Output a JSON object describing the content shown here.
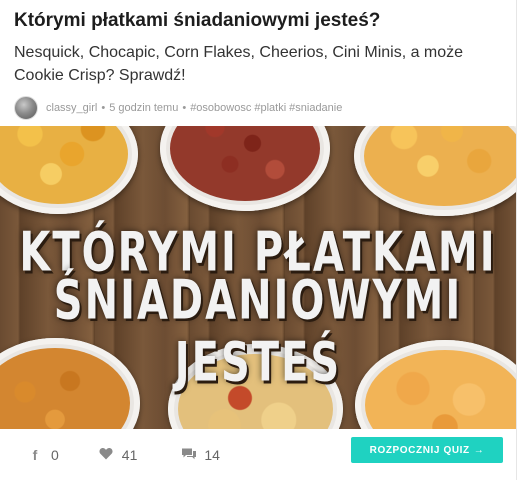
{
  "quiz": {
    "title": "Którymi płatkami śniadaniowymi jesteś?",
    "description": "Nesquick, Chocapic, Corn Flakes, Cheerios, Cini Minis, a może Cookie Crisp? Sprawdź!",
    "author": "classy_girl",
    "separator": "•",
    "time": "5 godzin temu",
    "tags": [
      "#osobowosc",
      "#platki",
      "#sniadanie"
    ]
  },
  "image": {
    "line1": "KTÓRYMI PŁATKAMI",
    "line2": "ŚNIADANIOWYMI JESTEŚ"
  },
  "stats": {
    "shares": "0",
    "likes": "41",
    "comments": "14"
  },
  "button": {
    "label": "ROZPOCZNIJ QUIZ",
    "arrow": "→"
  },
  "icons": {
    "facebook": "facebook-icon",
    "heart": "heart-icon",
    "comment": "comment-icon"
  },
  "colors": {
    "accent": "#1fd2c1",
    "title": "#1d1d1d",
    "meta": "#9a9a9a"
  }
}
